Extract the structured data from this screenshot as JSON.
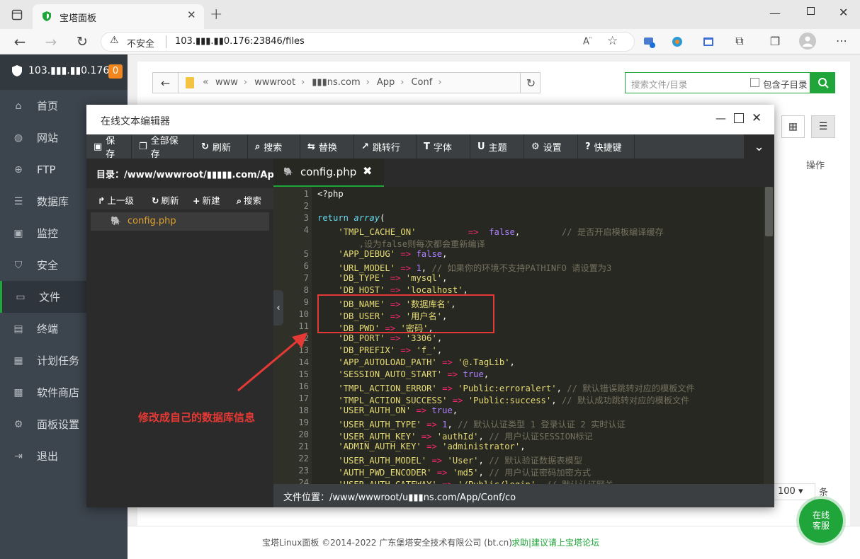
{
  "browser": {
    "tab_title": "宝塔面板",
    "insecure": "不安全",
    "url": "103.▮▮▮.▮▮0.176:23846/files"
  },
  "sidebar": {
    "host": "103.▮▮▮.▮▮0.176",
    "badge": "0",
    "items": [
      {
        "label": "首页",
        "icon": "home-icon"
      },
      {
        "label": "网站",
        "icon": "globe-icon"
      },
      {
        "label": "FTP",
        "icon": "ftp-icon"
      },
      {
        "label": "数据库",
        "icon": "database-icon"
      },
      {
        "label": "监控",
        "icon": "monitor-icon"
      },
      {
        "label": "安全",
        "icon": "shield-icon"
      },
      {
        "label": "文件",
        "icon": "folder-icon"
      },
      {
        "label": "终端",
        "icon": "terminal-icon"
      },
      {
        "label": "计划任务",
        "icon": "calendar-icon"
      },
      {
        "label": "软件商店",
        "icon": "grid-icon"
      },
      {
        "label": "面板设置",
        "icon": "gear-icon"
      },
      {
        "label": "退出",
        "icon": "exit-icon"
      }
    ]
  },
  "filebrowser": {
    "path": [
      "www",
      "wwwroot",
      "▮▮▮ns.com",
      "App",
      "Conf"
    ],
    "search_placeholder": "搜索文件/目录",
    "include_subdir": "包含子目录",
    "col_ops": "操作",
    "page_size": "100",
    "page_unit": "条"
  },
  "editor": {
    "title": "在线文本编辑器",
    "toolbar": [
      "保存",
      "全部保存",
      "刷新",
      "搜索",
      "替换",
      "跳转行",
      "字体",
      "主题",
      "设置",
      "快捷键"
    ],
    "dir_label": "目录：/www/wwwroot/▮▮▮▮▮.com/Ap...",
    "side_actions": [
      "上一级",
      "刷新",
      "新建",
      "搜索"
    ],
    "files": [
      "config.php"
    ],
    "tab_name": "config.php",
    "status": "文件位置：/www/wwwroot/u▮▮▮ns.com/App/Conf/co",
    "code": [
      {
        "n": "1",
        "t": "<?php"
      },
      {
        "n": "2",
        "t": ""
      },
      {
        "n": "3",
        "t": "return array("
      },
      {
        "n": "4",
        "t": "    'TMPL_CACHE_ON'          =>  false,        // 是否开启模板编译缓存"
      },
      {
        "n": "",
        "t": "        ,设为false则每次都会重新编译"
      },
      {
        "n": "5",
        "t": "    'APP_DEBUG' => false,"
      },
      {
        "n": "6",
        "t": "    'URL_MODEL' => 1, // 如果你的环境不支持PATHINFO 请设置为3"
      },
      {
        "n": "7",
        "t": "    'DB_TYPE' => 'mysql',"
      },
      {
        "n": "8",
        "t": "    'DB_HOST' => 'localhost',"
      },
      {
        "n": "9",
        "t": "    'DB_NAME' => '数据库名',"
      },
      {
        "n": "10",
        "t": "    'DB_USER' => '用户名',"
      },
      {
        "n": "11",
        "t": "    'DB_PWD' => '密码',"
      },
      {
        "n": "12",
        "t": "    'DB_PORT' => '3306',"
      },
      {
        "n": "13",
        "t": "    'DB_PREFIX' => 'f_',"
      },
      {
        "n": "14",
        "t": "    'APP_AUTOLOAD_PATH' => '@.TagLib',"
      },
      {
        "n": "15",
        "t": "    'SESSION_AUTO_START' => true,"
      },
      {
        "n": "16",
        "t": "    'TMPL_ACTION_ERROR' => 'Public:erroralert', // 默认错误跳转对应的模板文件"
      },
      {
        "n": "17",
        "t": "    'TMPL_ACTION_SUCCESS' => 'Public:success', // 默认成功跳转对应的模板文件"
      },
      {
        "n": "18",
        "t": "    'USER_AUTH_ON' => true,"
      },
      {
        "n": "19",
        "t": "    'USER_AUTH_TYPE' => 1, // 默认认证类型 1 登录认证 2 实时认证"
      },
      {
        "n": "20",
        "t": "    'USER_AUTH_KEY' => 'authId', // 用户认证SESSION标记"
      },
      {
        "n": "21",
        "t": "    'ADMIN_AUTH_KEY' => 'administrator',"
      },
      {
        "n": "22",
        "t": "    'USER_AUTH_MODEL' => 'User', // 默认验证数据表模型"
      },
      {
        "n": "23",
        "t": "    'AUTH_PWD_ENCODER' => 'md5', // 用户认证密码加密方式"
      },
      {
        "n": "24",
        "t": "    'USER_AUTH_GATEWAY' => '/Public/login', // 默认认证网关"
      }
    ]
  },
  "annotation": "修改成自己的数据库信息",
  "footer": {
    "copyright": "宝塔Linux面板 ©2014-2022 广东堡塔安全技术有限公司 (bt.cn)",
    "help": "求助|建议请上宝塔论坛"
  },
  "online_service": "在线\n客服",
  "colors": {
    "accent": "#20a53a",
    "highlight_box": "#e53935",
    "badge": "#f0861d"
  }
}
